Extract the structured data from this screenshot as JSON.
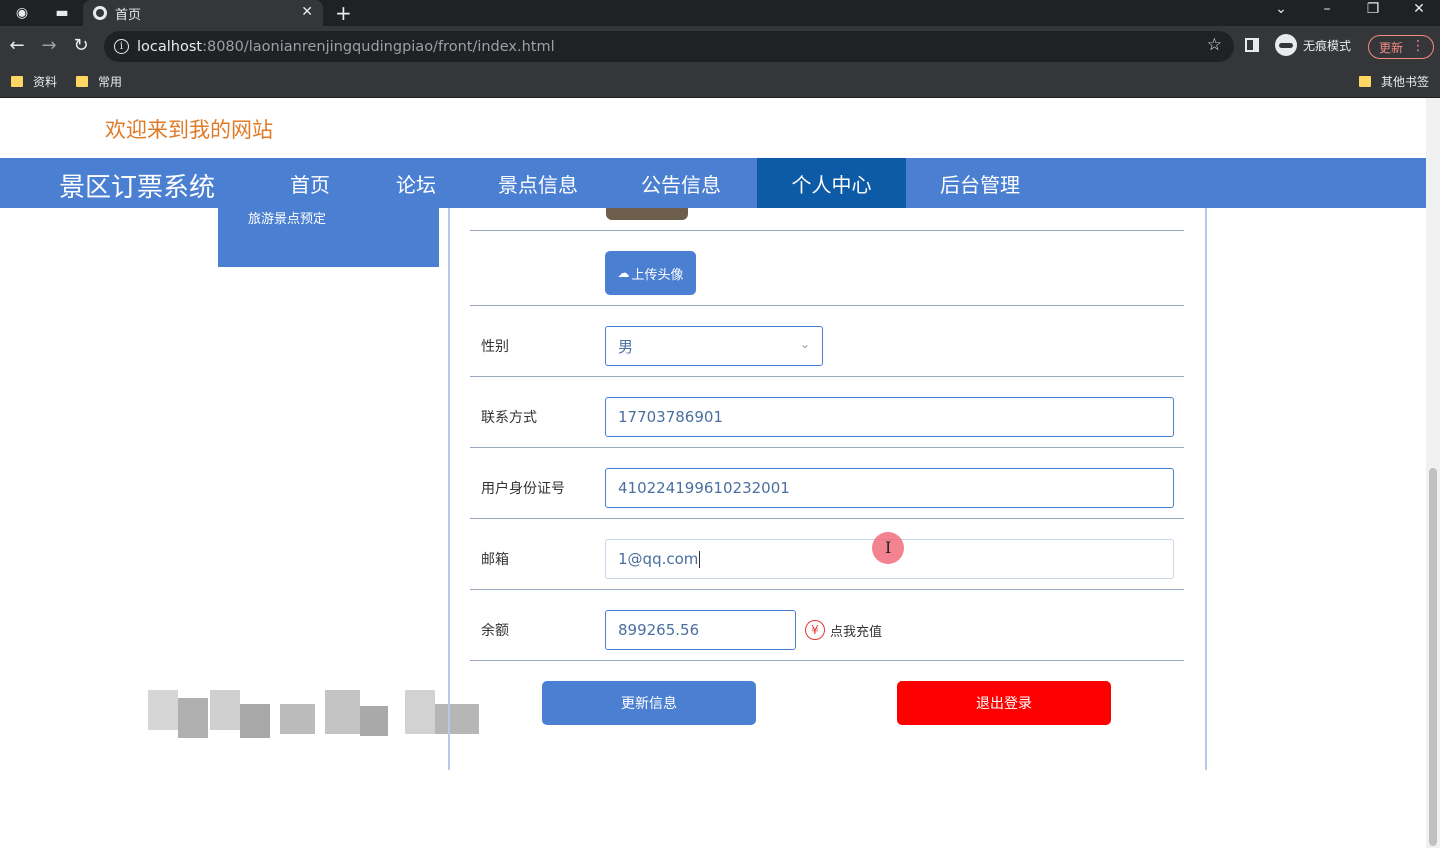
{
  "browser": {
    "tab_title": "首页",
    "url_host": "localhost",
    "url_path": ":8080/laonianrenjingqudingpiao/front/index.html",
    "incognito_label": "无痕模式",
    "update_label": "更新",
    "bookmarks": [
      "资料",
      "常用"
    ],
    "other_bookmarks": "其他书签"
  },
  "site": {
    "welcome": "欢迎来到我的网站",
    "brand": "景区订票系统",
    "nav": [
      "首页",
      "论坛",
      "景点信息",
      "公告信息",
      "个人中心",
      "后台管理"
    ],
    "active_nav": "个人中心",
    "side_menu_item": "旅游景点预定"
  },
  "form": {
    "upload_label": "上传头像",
    "gender_label": "性别",
    "gender_value": "男",
    "phone_label": "联系方式",
    "phone_value": "17703786901",
    "idcard_label": "用户身份证号",
    "idcard_value": "410224199610232001",
    "email_label": "邮箱",
    "email_value": "1@qq.com",
    "balance_label": "余额",
    "balance_value": "899265.56",
    "recharge_symbol": "¥",
    "recharge_label": "点我充值",
    "update_button": "更新信息",
    "logout_button": "退出登录"
  },
  "colors": {
    "primary": "#4a7fd1",
    "active_nav": "#0d5aa6",
    "danger": "#ff0000",
    "welcome": "#e07b2a"
  }
}
